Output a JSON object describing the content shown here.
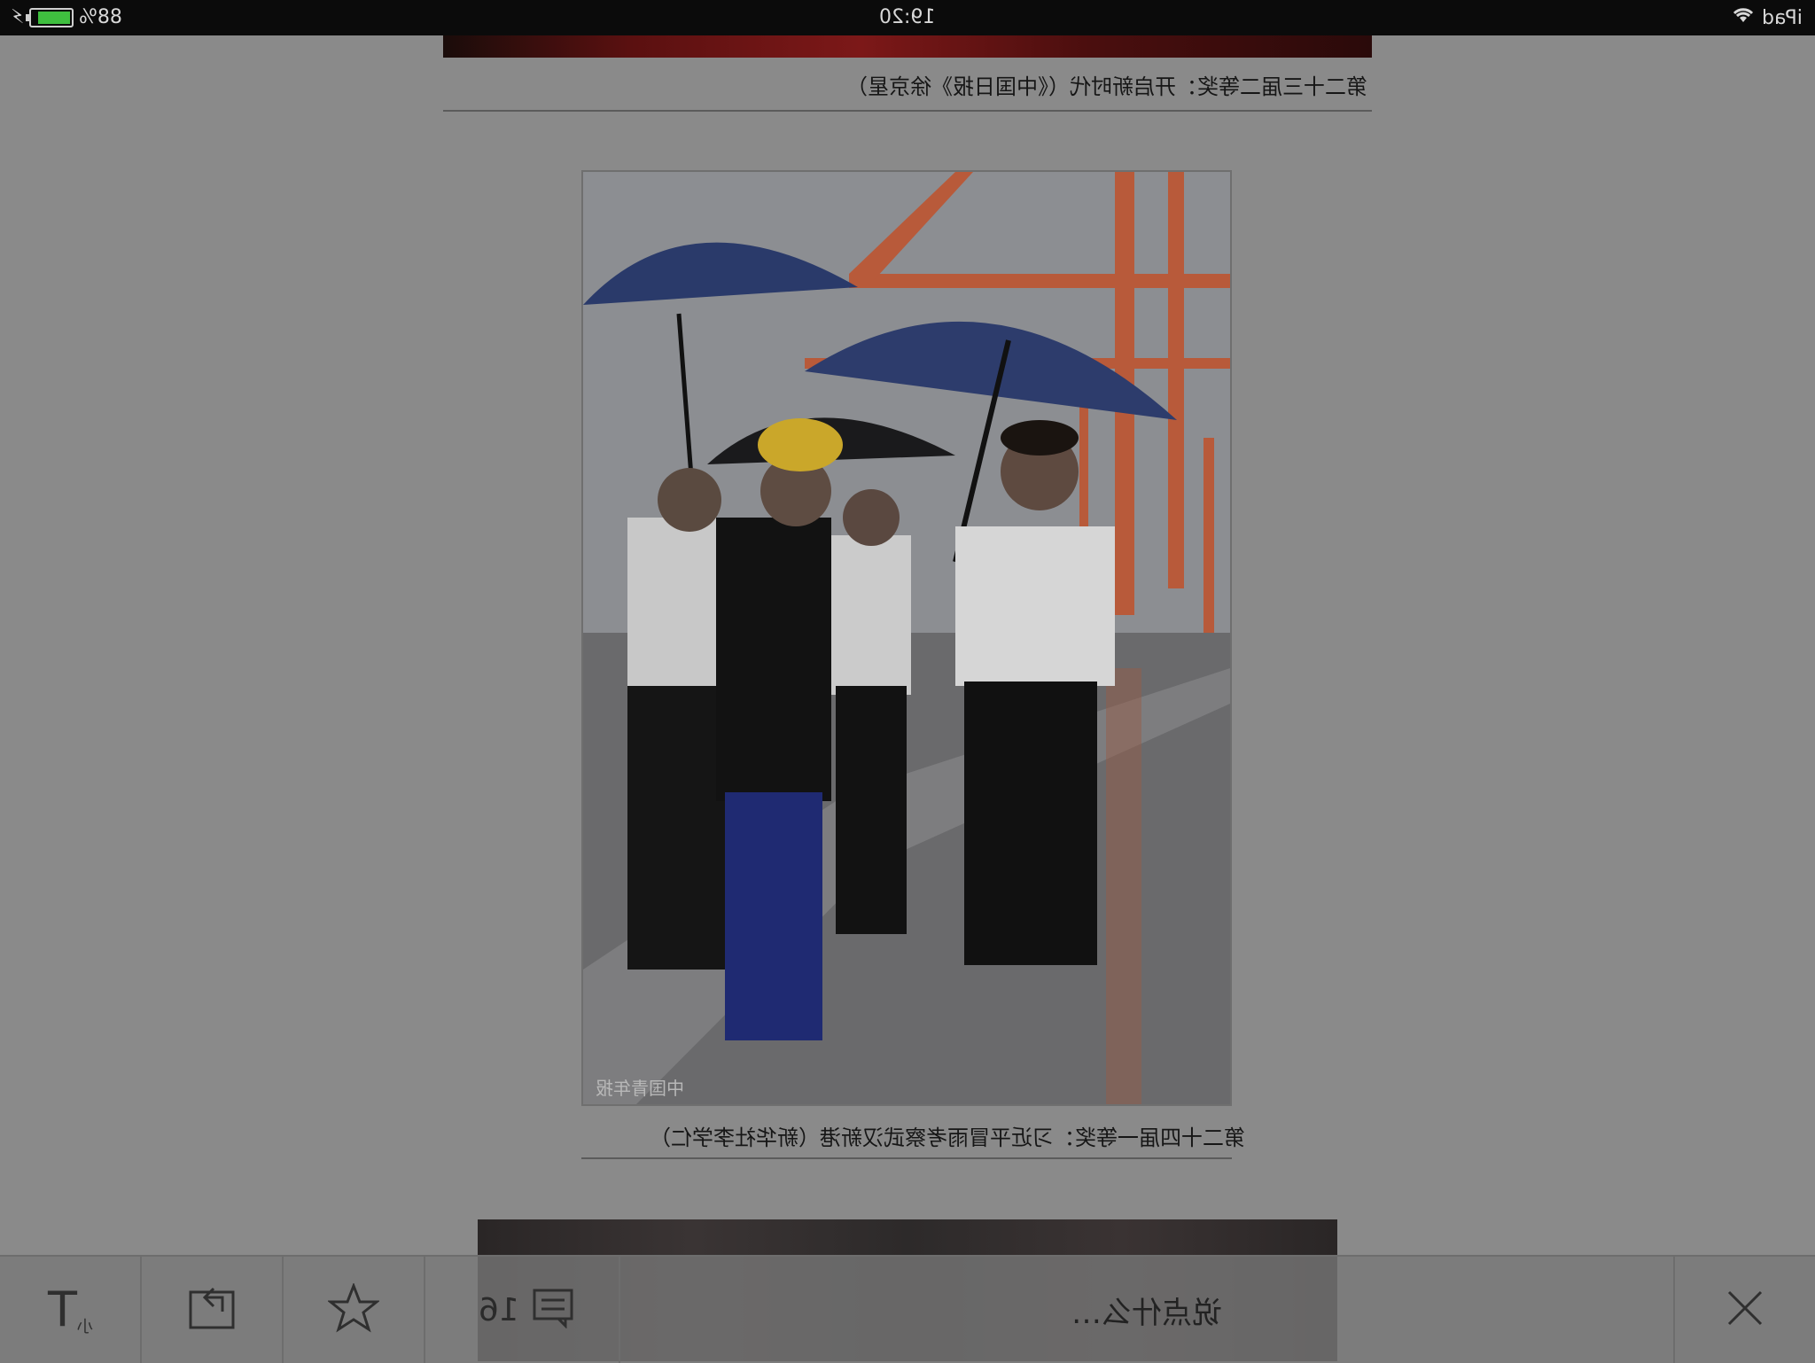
{
  "status_bar": {
    "battery_text": "88%",
    "time": "19:20",
    "device": "iPad"
  },
  "article": {
    "caption_top": "第二十三届二等奖：开启新时代（《中国日报》徐京星）",
    "photo_watermark": "中国青年报",
    "caption_main": "第二十四届一等奖：习近平冒雨考察武汉新港（新华社李学仁）"
  },
  "toolbar": {
    "font_button_label": "小",
    "share_icon": "share-icon",
    "favorite_icon": "star-icon",
    "comment_count": "16",
    "comment_placeholder": "说点什么…",
    "close_icon": "close-icon"
  }
}
